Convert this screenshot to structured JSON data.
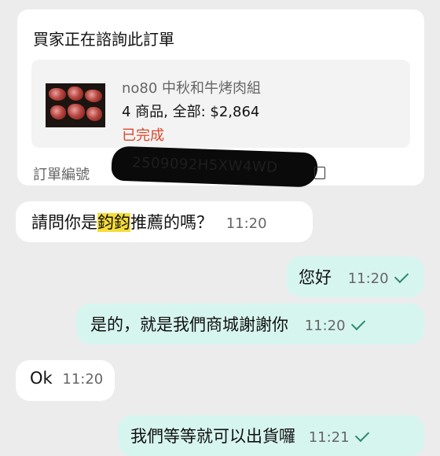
{
  "card": {
    "title": "買家正在諮詢此訂單",
    "product_name": "no80 中秋和牛烤肉組",
    "summary": "4 商品, 全部: $2,864",
    "status": "已完成",
    "order_label": "訂單編號",
    "order_no": "2509092H5XW4WD"
  },
  "messages": [
    {
      "dir": "in",
      "pre": "請問你是",
      "hl": "鈞鈞",
      "post": "推薦的嗎？",
      "time": "11:20"
    },
    {
      "dir": "out",
      "text": "您好",
      "time": "11:20"
    },
    {
      "dir": "out",
      "text": "是的，就是我們商城謝謝你",
      "time": "11:20"
    },
    {
      "dir": "in",
      "text": "Ok",
      "time": "11:20"
    },
    {
      "dir": "out",
      "text": "我們等等就可以出貨囉",
      "time": "11:21"
    }
  ],
  "colors": {
    "incoming": "#ffffff",
    "outgoing": "#d7f5ef",
    "highlight": "#f5dc3a",
    "status": "#d9482b",
    "check": "#2e8b6d"
  }
}
